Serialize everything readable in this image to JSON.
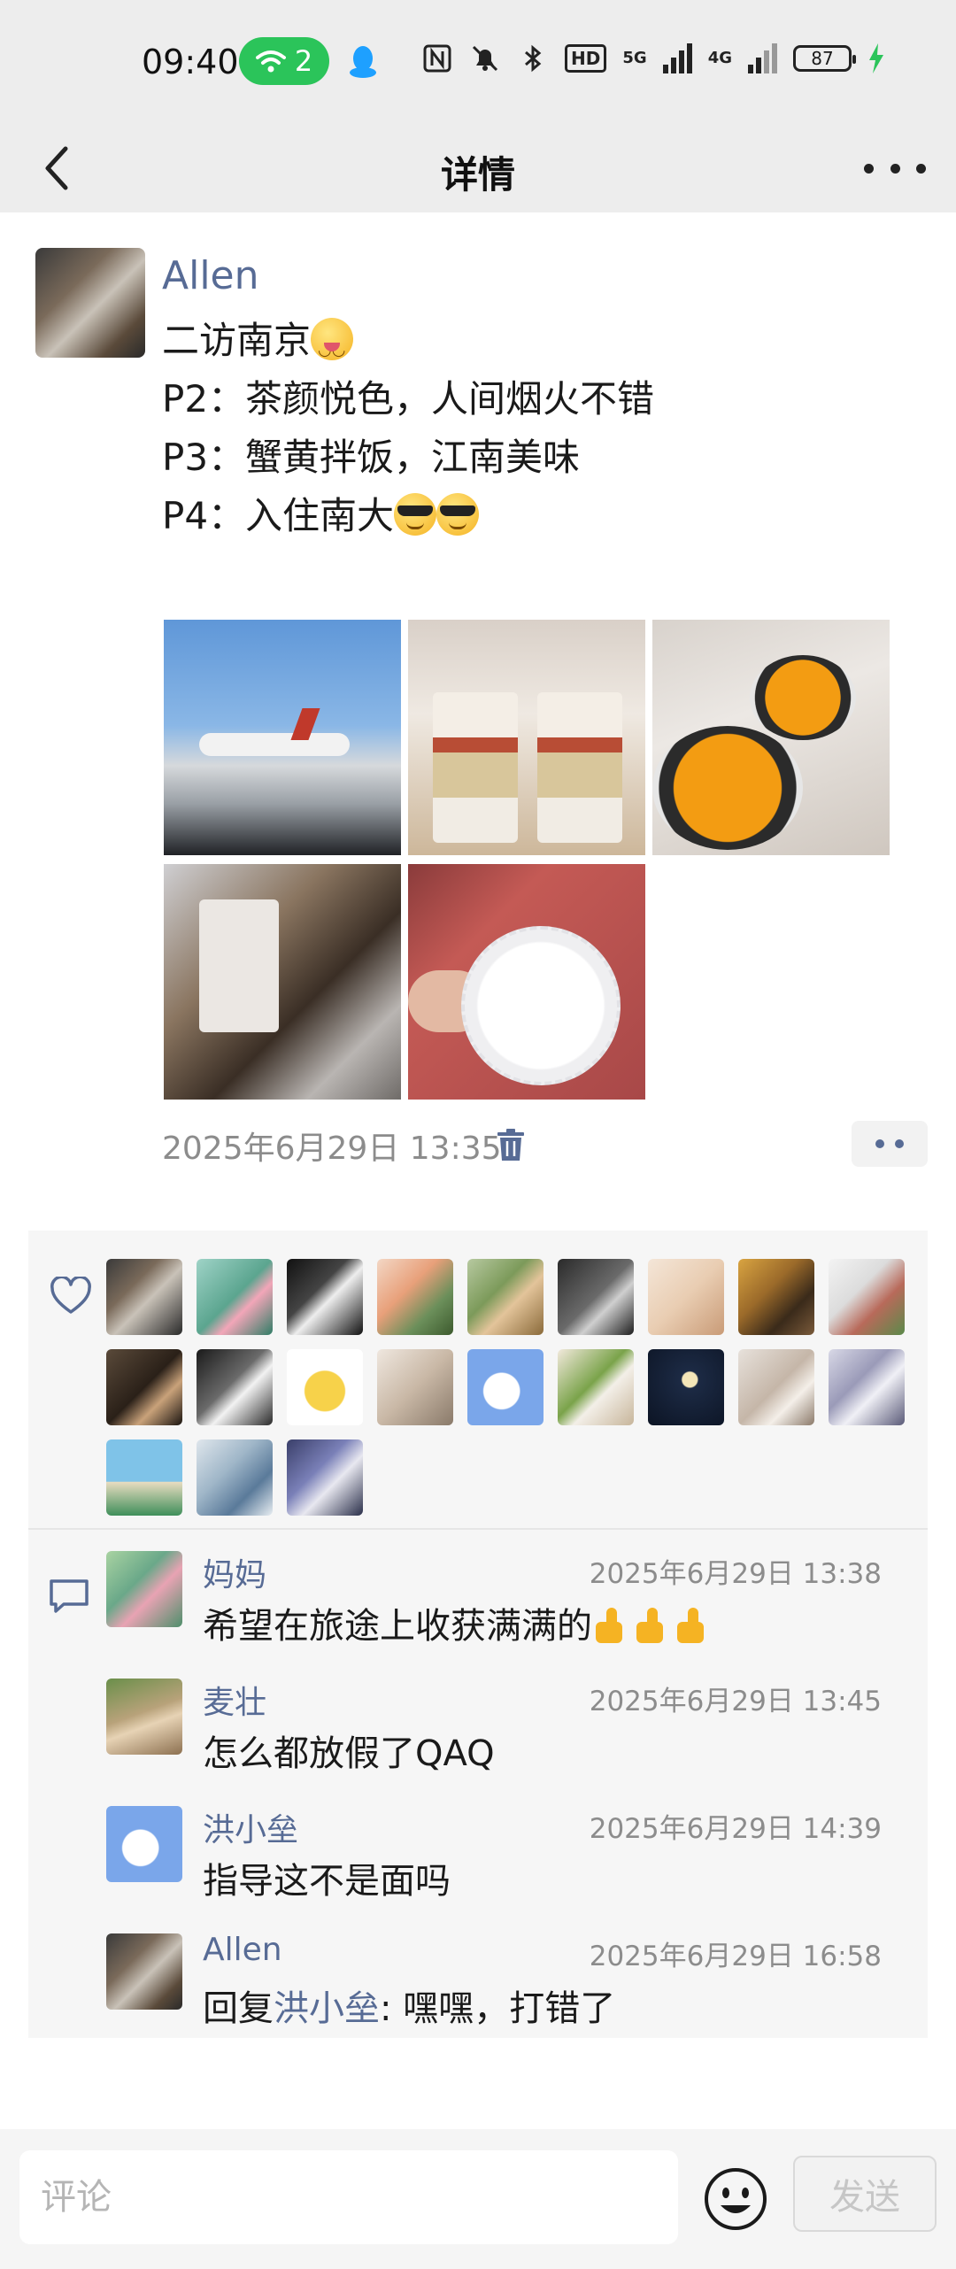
{
  "status_bar": {
    "time": "09:40",
    "wifi_badge": "2",
    "battery": "87",
    "hd_label": "HD",
    "net_5g": "5G",
    "net_4g": "4G"
  },
  "nav": {
    "title": "详情"
  },
  "post": {
    "author": "Allen",
    "lines": [
      "二访南京",
      "P2：茶颜悦色，人间烟火不错",
      "P3：蟹黄拌饭，江南美味",
      "P4：入住南大"
    ],
    "timestamp": "2025年6月29日 13:35",
    "photo_count": 5
  },
  "likes": {
    "count": 21
  },
  "comments": [
    {
      "name": "妈妈",
      "time": "2025年6月29日 13:38",
      "text": "希望在旅途上收获满满的"
    },
    {
      "name": "麦壮",
      "time": "2025年6月29日 13:45",
      "text": "怎么都放假了QAQ"
    },
    {
      "name": "洪小垒",
      "time": "2025年6月29日 14:39",
      "text": "指导这不是面吗"
    },
    {
      "name": "Allen",
      "time": "2025年6月29日 16:58",
      "reply_prefix": "回复",
      "reply_to": "洪小垒",
      "text": ": 嘿嘿，打错了"
    }
  ],
  "comment_bar": {
    "placeholder": "评论",
    "send_label": "发送"
  },
  "colors": {
    "link": "#576b95",
    "header_bg": "#ededed",
    "interaction_bg": "#f6f6f6",
    "wifi_badge": "#2bc45a"
  }
}
